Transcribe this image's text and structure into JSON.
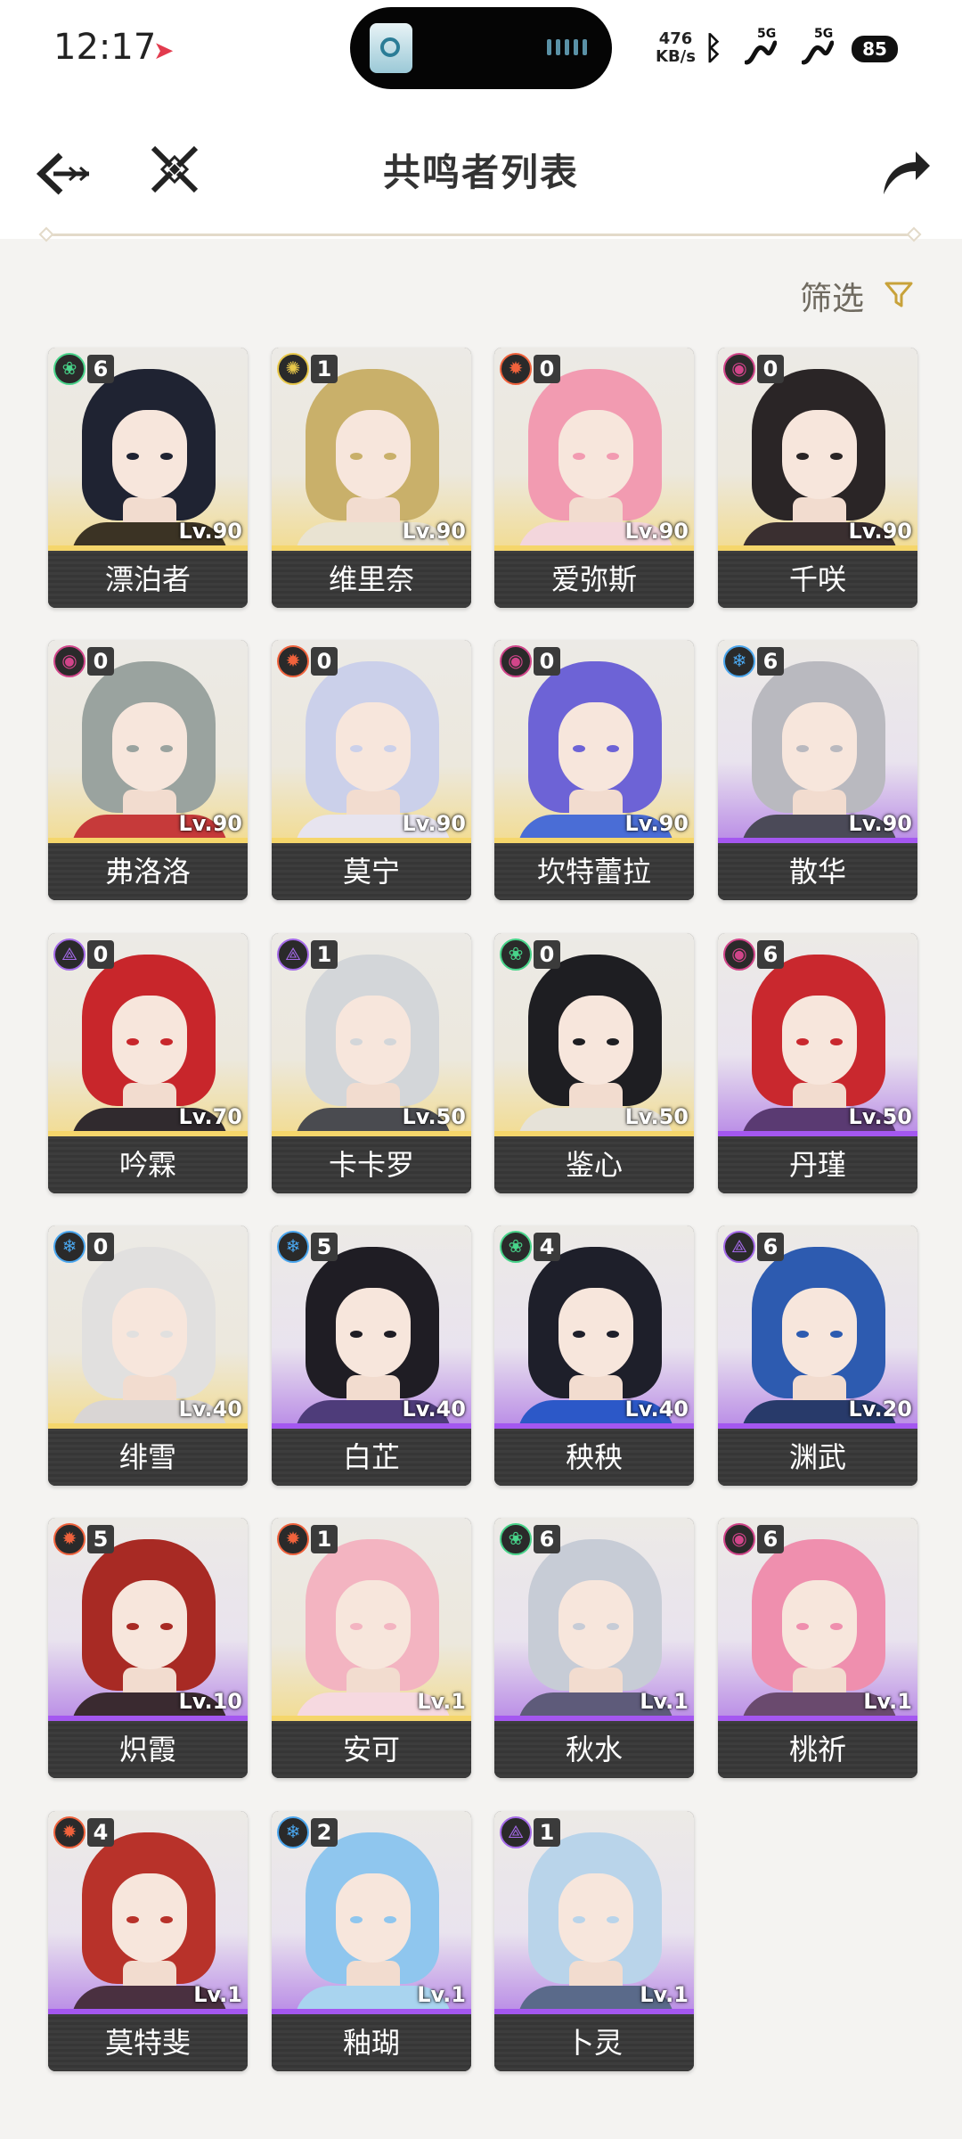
{
  "status_bar": {
    "time": "12:17",
    "net_speed_value": "476",
    "net_speed_unit": "KB/s",
    "signal_label_1": "5G",
    "signal_label_2": "5G",
    "battery": "85"
  },
  "header": {
    "title": "共鸣者列表",
    "filter_label": "筛选"
  },
  "element_colors": {
    "aero": "#48d48a",
    "spectro": "#e8c84a",
    "fusion": "#f0623c",
    "havoc": "#d1458a",
    "glacio": "#4aa6ee",
    "electro": "#a46ae8"
  },
  "resonators": [
    {
      "name": "漂泊者",
      "level": "Lv.90",
      "chain": "6",
      "element": "aero",
      "rarity": 5,
      "hair": "#1f2332",
      "cloth": "#3b3324"
    },
    {
      "name": "维里奈",
      "level": "Lv.90",
      "chain": "1",
      "element": "spectro",
      "rarity": 5,
      "hair": "#c9b06a",
      "cloth": "#e9e3d2"
    },
    {
      "name": "爱弥斯",
      "level": "Lv.90",
      "chain": "0",
      "element": "fusion",
      "rarity": 5,
      "hair": "#f29bb1",
      "cloth": "#f3d6dc"
    },
    {
      "name": "千咲",
      "level": "Lv.90",
      "chain": "0",
      "element": "havoc",
      "rarity": 5,
      "hair": "#2a2526",
      "cloth": "#3a2f30"
    },
    {
      "name": "弗洛洛",
      "level": "Lv.90",
      "chain": "0",
      "element": "havoc",
      "rarity": 5,
      "hair": "#9aa39f",
      "cloth": "#c63a3a"
    },
    {
      "name": "莫宁",
      "level": "Lv.90",
      "chain": "0",
      "element": "fusion",
      "rarity": 5,
      "hair": "#cbd0ea",
      "cloth": "#e7e4ef"
    },
    {
      "name": "坎特蕾拉",
      "level": "Lv.90",
      "chain": "0",
      "element": "havoc",
      "rarity": 5,
      "hair": "#6d63d6",
      "cloth": "#4a6dd6"
    },
    {
      "name": "散华",
      "level": "Lv.90",
      "chain": "6",
      "element": "glacio",
      "rarity": 4,
      "hair": "#b9b9bf",
      "cloth": "#4b4a58"
    },
    {
      "name": "吟霖",
      "level": "Lv.70",
      "chain": "0",
      "element": "electro",
      "rarity": 5,
      "hair": "#c8262b",
      "cloth": "#302a2e"
    },
    {
      "name": "卡卡罗",
      "level": "Lv.50",
      "chain": "1",
      "element": "electro",
      "rarity": 5,
      "hair": "#d3d6d9",
      "cloth": "#4a4b50"
    },
    {
      "name": "鉴心",
      "level": "Lv.50",
      "chain": "0",
      "element": "aero",
      "rarity": 5,
      "hair": "#1e1e22",
      "cloth": "#e6e2d8"
    },
    {
      "name": "丹瑾",
      "level": "Lv.50",
      "chain": "6",
      "element": "havoc",
      "rarity": 4,
      "hair": "#c9282e",
      "cloth": "#5a3a72"
    },
    {
      "name": "绯雪",
      "level": "Lv.40",
      "chain": "0",
      "element": "glacio",
      "rarity": 5,
      "hair": "#e1e0df",
      "cloth": "#d9d5d4"
    },
    {
      "name": "白芷",
      "level": "Lv.40",
      "chain": "5",
      "element": "glacio",
      "rarity": 4,
      "hair": "#1f1d24",
      "cloth": "#4e3c7a"
    },
    {
      "name": "秧秧",
      "level": "Lv.40",
      "chain": "4",
      "element": "aero",
      "rarity": 4,
      "hair": "#1e1f2a",
      "cloth": "#2c58c8"
    },
    {
      "name": "渊武",
      "level": "Lv.20",
      "chain": "6",
      "element": "electro",
      "rarity": 4,
      "hair": "#2d5bb0",
      "cloth": "#283a6a"
    },
    {
      "name": "炽霞",
      "level": "Lv.10",
      "chain": "5",
      "element": "fusion",
      "rarity": 4,
      "hair": "#a82a24",
      "cloth": "#3a2a30"
    },
    {
      "name": "安可",
      "level": "Lv.1",
      "chain": "1",
      "element": "fusion",
      "rarity": 5,
      "hair": "#f3b4c1",
      "cloth": "#f6d9e0"
    },
    {
      "name": "秋水",
      "level": "Lv.1",
      "chain": "6",
      "element": "aero",
      "rarity": 4,
      "hair": "#c7ccd6",
      "cloth": "#5e5b7a"
    },
    {
      "name": "桃祈",
      "level": "Lv.1",
      "chain": "6",
      "element": "havoc",
      "rarity": 4,
      "hair": "#ef8fae",
      "cloth": "#6a4a6e"
    },
    {
      "name": "莫特斐",
      "level": "Lv.1",
      "chain": "4",
      "element": "fusion",
      "rarity": 4,
      "hair": "#b8322a",
      "cloth": "#4a3040"
    },
    {
      "name": "釉瑚",
      "level": "Lv.1",
      "chain": "2",
      "element": "glacio",
      "rarity": 4,
      "hair": "#8fc6ee",
      "cloth": "#a9d4ef"
    },
    {
      "name": "卜灵",
      "level": "Lv.1",
      "chain": "1",
      "element": "electro",
      "rarity": 4,
      "hair": "#b9d4ea",
      "cloth": "#5a6a8a"
    }
  ]
}
